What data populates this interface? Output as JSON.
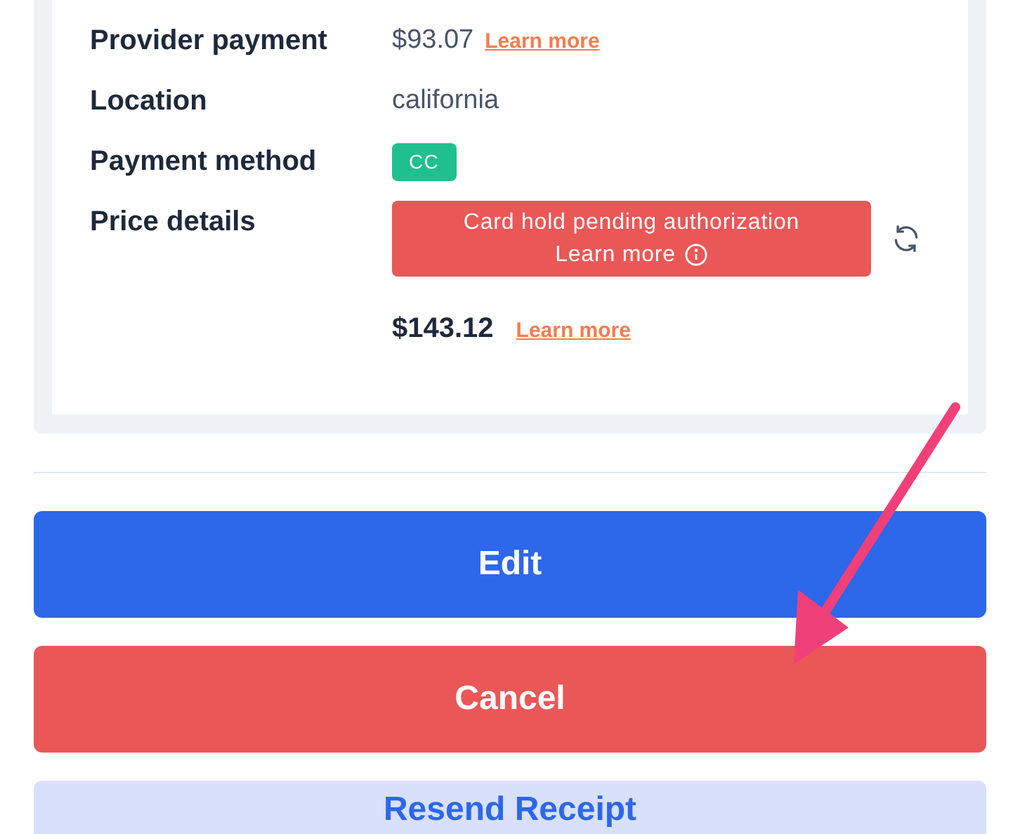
{
  "details": [
    {
      "kind": "amount",
      "label": "Provider payment",
      "value": "$93.07",
      "link": "Learn more"
    },
    {
      "kind": "text",
      "label": "Location",
      "value": "california"
    },
    {
      "kind": "badge",
      "label": "Payment method",
      "value": "CC"
    },
    {
      "kind": "alert",
      "label": "Price details",
      "alert_line1": "Card hold pending authorization",
      "alert_link": "Learn more",
      "total": "$143.12",
      "link": "Learn more"
    }
  ],
  "buttons": [
    {
      "kind": "primary",
      "label": "Edit"
    },
    {
      "kind": "danger",
      "label": "Cancel"
    },
    {
      "kind": "secondary",
      "label": "Resend Receipt"
    }
  ]
}
